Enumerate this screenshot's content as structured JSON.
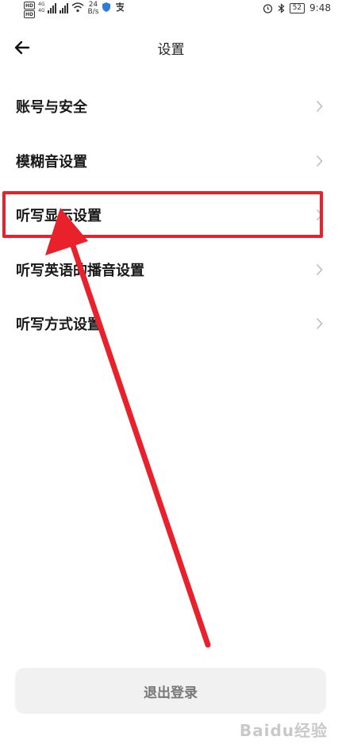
{
  "status_bar": {
    "hd1": "HD",
    "hd2": "HD",
    "net1": "4G",
    "net2": "4G",
    "speed_value": "24",
    "speed_unit": "B/s",
    "battery": "52",
    "time": "9:48"
  },
  "header": {
    "title": "设置"
  },
  "menu": {
    "items": [
      {
        "label": "账号与安全"
      },
      {
        "label": "模糊音设置"
      },
      {
        "label": "听写显示设置"
      },
      {
        "label": "听写英语的播音设置"
      },
      {
        "label": "听写方式设置"
      }
    ]
  },
  "logout": {
    "label": "退出登录"
  },
  "watermark": {
    "text": "Baidu经验"
  },
  "colors": {
    "annotation_red": "#e8212b",
    "chevron": "#bdbdbd"
  },
  "icons": {
    "back": "arrow-left-icon",
    "chevron": "chevron-right-icon"
  }
}
